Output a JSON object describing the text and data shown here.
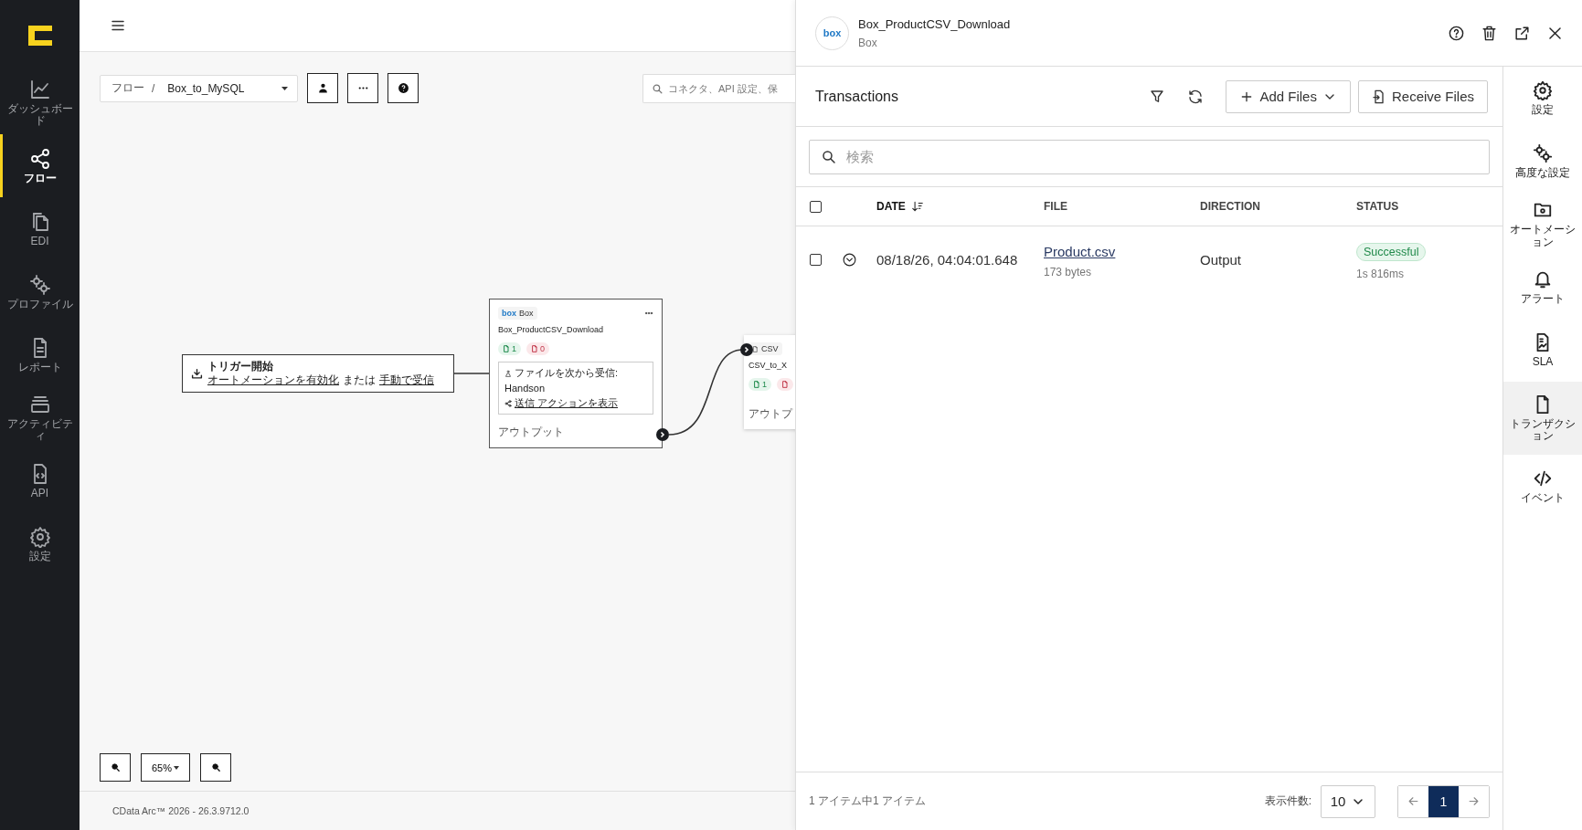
{
  "sidebar": {
    "items": [
      {
        "label": "ダッシュボード",
        "selected": false
      },
      {
        "label": "フロー",
        "selected": true
      },
      {
        "label": "EDI",
        "selected": false
      },
      {
        "label": "プロファイル",
        "selected": false
      },
      {
        "label": "レポート",
        "selected": false
      },
      {
        "label": "アクティビティ",
        "selected": false
      },
      {
        "label": "API",
        "selected": false
      },
      {
        "label": "設定",
        "selected": false
      }
    ]
  },
  "toolbar": {
    "breadcrumb_root": "フロー",
    "breadcrumb_separator": "/",
    "flow_name": "Box_to_MySQL",
    "search": {
      "placeholder": "コネクタ、API 設定、保"
    }
  },
  "canvas": {
    "trigger": {
      "title": "トリガー開始",
      "link_1": "オートメーションを有効化",
      "joiner": "または",
      "link_2": "手動で受信"
    },
    "nodes": [
      {
        "kind": "full",
        "chip": "Box",
        "chip_logo": "box",
        "name": "Box_ProductCSV_Download",
        "success_count": "1",
        "error_count": "0",
        "receive_label": "ファイルを次から受信:",
        "receive_from": "Handson",
        "send_link": "送信 アクションを表示",
        "output_label": "アウトプット"
      },
      {
        "kind": "cut",
        "chip": "CSV",
        "name": "CSV_to_X",
        "success_count": "1",
        "output_label": "アウトプ"
      }
    ]
  },
  "zoom": {
    "level_label": "65%"
  },
  "footer": {
    "version": "CData Arc™ 2026 - 26.3.9712.0"
  },
  "panel": {
    "logo": "box",
    "title": "Box_ProductCSV_Download",
    "subtitle": "Box",
    "section_title": "Transactions",
    "add_files": "Add Files",
    "receive_files": "Receive Files",
    "search": {
      "placeholder": "検索"
    },
    "table": {
      "select_all_checked": false,
      "columns": [
        {
          "label": "DATE",
          "sorted": true
        },
        {
          "label": "FILE",
          "sorted": false
        },
        {
          "label": "DIRECTION",
          "sorted": false
        },
        {
          "label": "STATUS",
          "sorted": false
        }
      ],
      "rows": [
        {
          "checked": false,
          "expanded": false,
          "date": "08/18/26, 04:04:01.648",
          "file": "Product.csv",
          "size": "173 bytes",
          "direction": "Output",
          "status": "Successful",
          "duration": "1s 816ms"
        }
      ]
    },
    "summary": "1 アイテム中1 アイテム",
    "page_size_label": "表示件数:",
    "page_size": "10",
    "pages": [
      {
        "label": "1",
        "selected": true
      }
    ]
  },
  "rail": {
    "items": [
      {
        "label": "設定",
        "selected": false
      },
      {
        "label": "高度な設定",
        "selected": false
      },
      {
        "label": "オートメーション",
        "selected": false
      },
      {
        "label": "アラート",
        "selected": false
      },
      {
        "label": "SLA",
        "selected": false
      },
      {
        "label": "トランザクション",
        "selected": true
      },
      {
        "label": "イベント",
        "selected": false
      }
    ]
  }
}
